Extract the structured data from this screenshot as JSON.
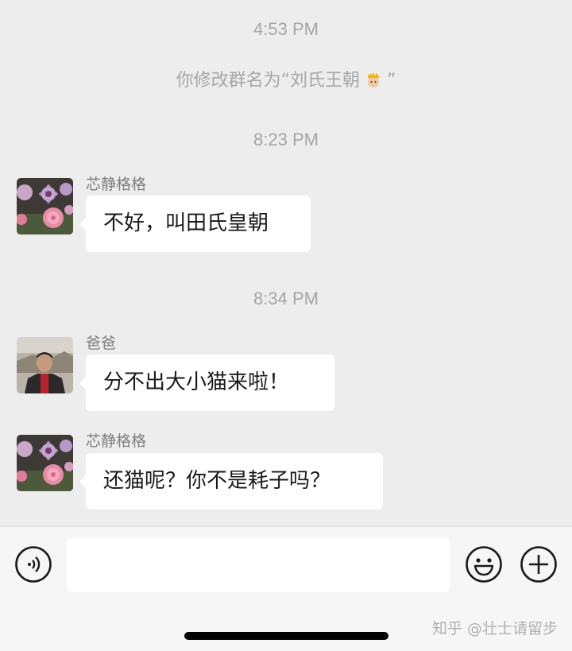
{
  "chat": {
    "timestamps": [
      "4:53 PM",
      "8:23 PM",
      "8:34 PM"
    ],
    "system_message": {
      "before": "你修改群名为“刘氏王朝",
      "emoji": "crown-person-emoji",
      "after": "”"
    },
    "messages": [
      {
        "sender": "芯静格格",
        "text": "不好，叫田氏皇朝",
        "avatar": "flower-avatar"
      },
      {
        "sender": "爸爸",
        "text": "分不出大小猫来啦！",
        "avatar": "man-avatar"
      },
      {
        "sender": "芯静格格",
        "text": "还猫呢？你不是耗子吗？",
        "avatar": "flower-avatar"
      }
    ]
  },
  "input_bar": {
    "voice_icon": "voice-icon",
    "emoji_icon": "emoji-icon",
    "plus_icon": "plus-icon",
    "text_value": ""
  },
  "watermark": "知乎 @壮士请留步"
}
